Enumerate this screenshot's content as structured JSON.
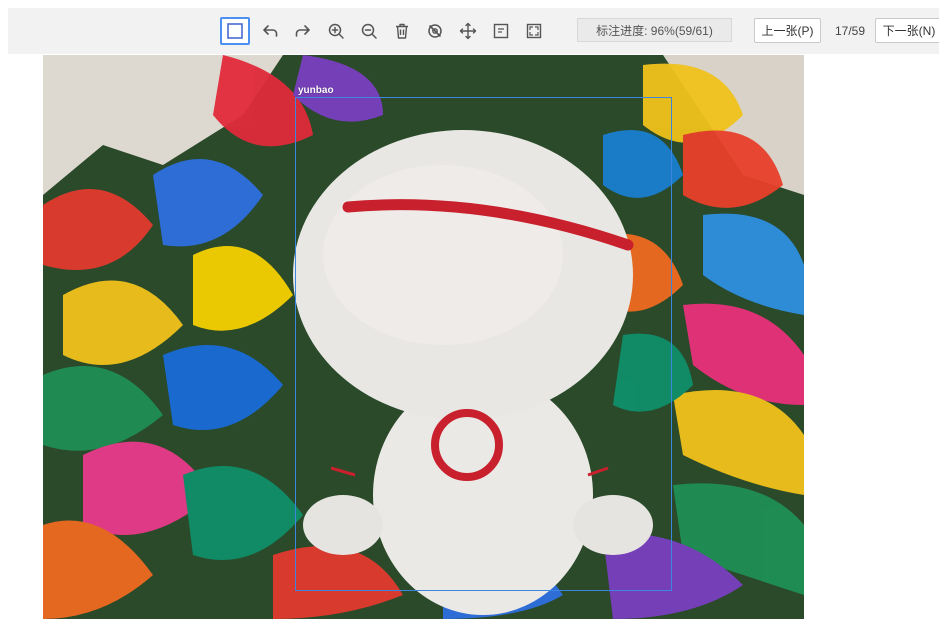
{
  "toolbar": {
    "tools": [
      {
        "name": "rect-tool",
        "icon": "square-icon",
        "active": true
      },
      {
        "name": "undo-tool",
        "icon": "undo-arrow-icon"
      },
      {
        "name": "redo-tool",
        "icon": "redo-arrow-icon"
      },
      {
        "name": "zoom-in-tool",
        "icon": "zoom-in-icon"
      },
      {
        "name": "zoom-out-tool",
        "icon": "zoom-out-icon"
      },
      {
        "name": "delete-tool",
        "icon": "trash-icon"
      },
      {
        "name": "hide-tool",
        "icon": "eye-off-icon"
      },
      {
        "name": "move-tool",
        "icon": "move-icon"
      },
      {
        "name": "label-tool",
        "icon": "label-box-icon"
      },
      {
        "name": "fit-tool",
        "icon": "fullscreen-icon"
      }
    ],
    "progress_text": "标注进度: 96%(59/61)",
    "prev_label": "上一张(P)",
    "page_count": "17/59",
    "next_label": "下一张(N)",
    "accent": "#4e8ff2"
  },
  "annotation": {
    "label": "yunbao",
    "box_color": "#3b86e0"
  }
}
